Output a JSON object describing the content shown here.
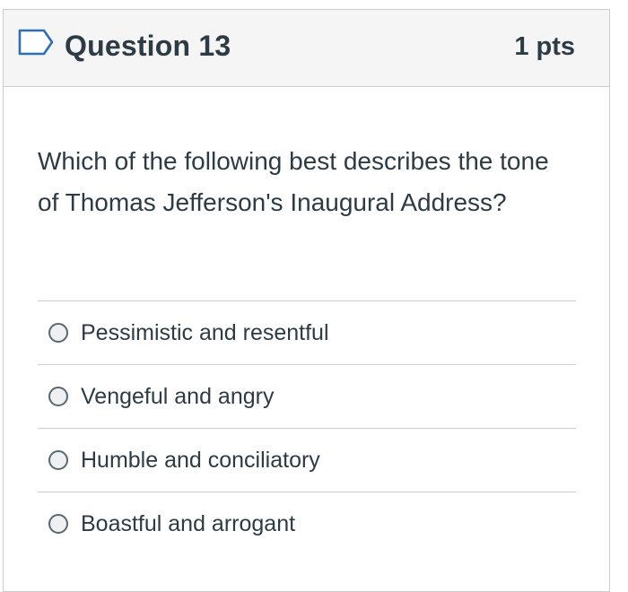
{
  "question": {
    "title": "Question 13",
    "points": "1 pts",
    "text": "Which of the following best describes the tone of Thomas Jefferson's Inaugural Address?",
    "flag_icon": "flag-outline-icon",
    "accent_color": "#2d6fb7"
  },
  "answers": [
    {
      "label": "Pessimistic and resentful"
    },
    {
      "label": "Vengeful and angry"
    },
    {
      "label": "Humble and conciliatory"
    },
    {
      "label": "Boastful and arrogant"
    }
  ]
}
